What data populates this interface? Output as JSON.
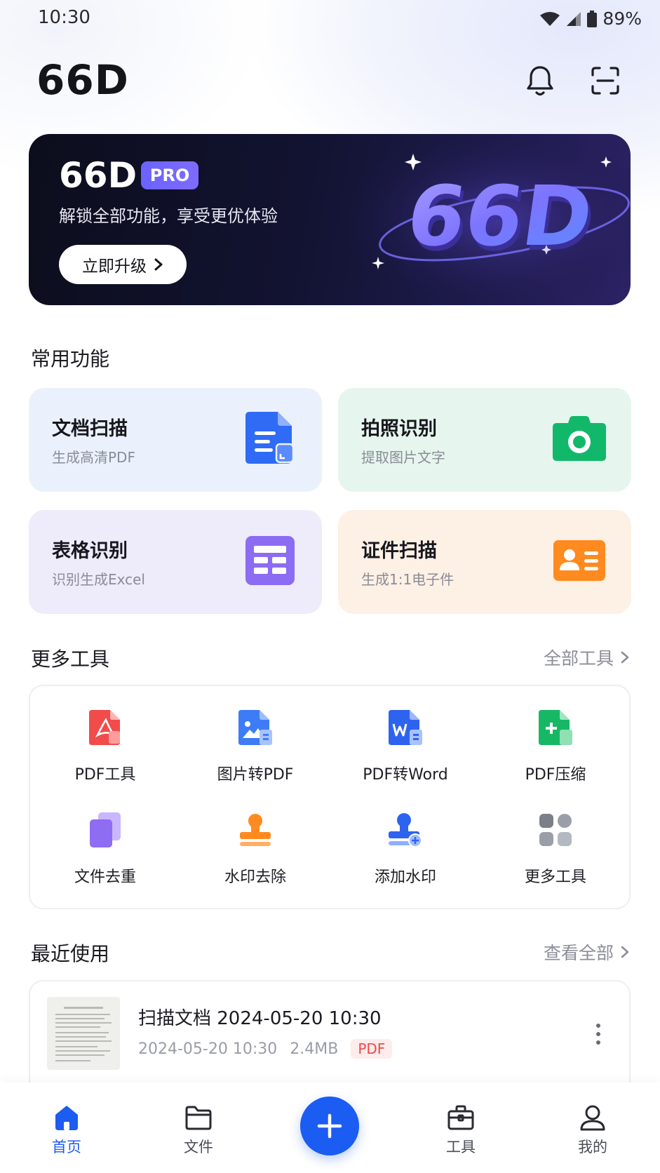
{
  "status_bar": {
    "time": "10:30",
    "battery": "89%"
  },
  "header": {
    "app_title": "66D"
  },
  "banner": {
    "title": "66D",
    "badge": "PRO",
    "subtitle": "解锁全部功能，享受更优体验",
    "cta": "立即升级",
    "art_text": "66D"
  },
  "common": {
    "title": "常用功能",
    "cards": [
      {
        "title": "文档扫描",
        "subtitle": "生成高清PDF",
        "icon": "document-scan-icon",
        "color": "#2f6bf5"
      },
      {
        "title": "拍照识别",
        "subtitle": "提取图片文字",
        "icon": "camera-icon",
        "color": "#12b86a"
      },
      {
        "title": "表格识别",
        "subtitle": "识别生成Excel",
        "icon": "table-icon",
        "color": "#8c6cf2"
      },
      {
        "title": "证件扫描",
        "subtitle": "生成1:1电子件",
        "icon": "id-card-icon",
        "color": "#ff8a1f"
      }
    ]
  },
  "tools": {
    "title": "更多工具",
    "link": "全部工具",
    "items": [
      {
        "label": "PDF工具",
        "icon": "pdf-tool-icon"
      },
      {
        "label": "图片转PDF",
        "icon": "image-to-pdf-icon"
      },
      {
        "label": "PDF转Word",
        "icon": "pdf-to-word-icon"
      },
      {
        "label": "PDF压缩",
        "icon": "pdf-compress-icon"
      },
      {
        "label": "文件去重",
        "icon": "dedupe-files-icon"
      },
      {
        "label": "水印去除",
        "icon": "remove-watermark-icon"
      },
      {
        "label": "添加水印",
        "icon": "add-watermark-icon"
      },
      {
        "label": "更多工具",
        "icon": "more-tools-icon"
      }
    ]
  },
  "recent": {
    "title": "最近使用",
    "link": "查看全部",
    "items": [
      {
        "name": "扫描文档 2024-05-20 10:30",
        "date": "2024-05-20 10:30",
        "size": "2.4MB",
        "type": "PDF"
      }
    ]
  },
  "nav": {
    "items": [
      {
        "label": "首页",
        "icon": "home-icon",
        "active": true
      },
      {
        "label": "文件",
        "icon": "folder-icon"
      },
      {
        "label": "",
        "icon": "plus-icon"
      },
      {
        "label": "工具",
        "icon": "toolbox-icon"
      },
      {
        "label": "我的",
        "icon": "profile-icon"
      }
    ]
  },
  "colors": {
    "accent": "#1b5cf2",
    "pro": "#6a63ff",
    "pdf_tag": "#ee4a4a"
  }
}
